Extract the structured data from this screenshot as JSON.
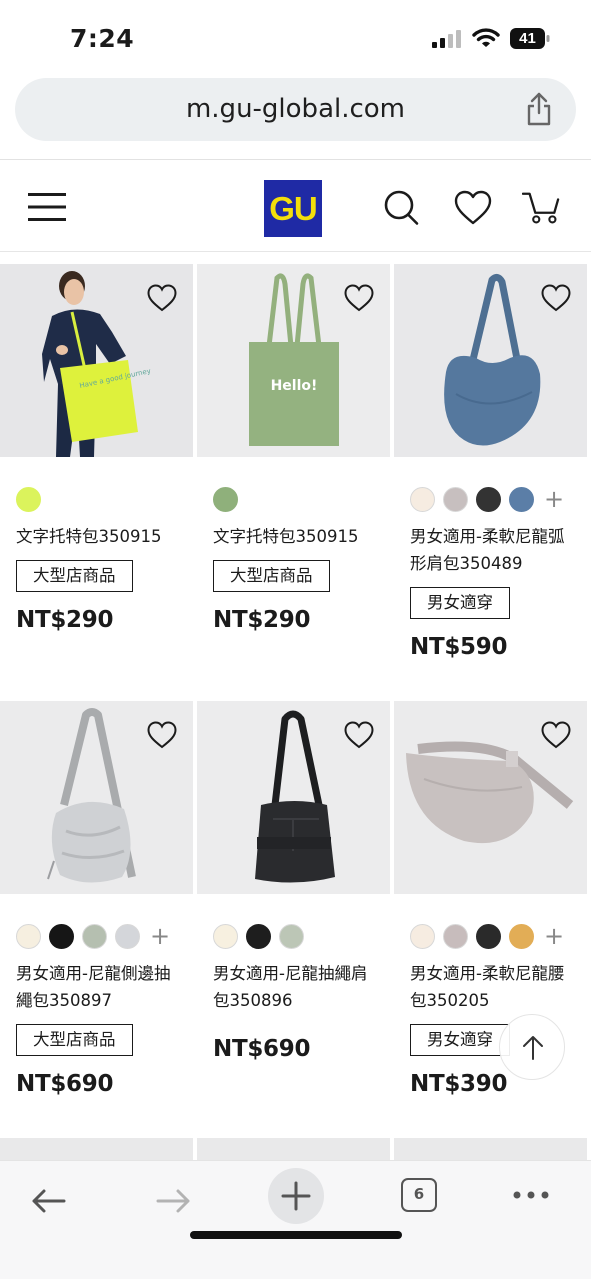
{
  "status_bar": {
    "time": "7:24",
    "battery": "41"
  },
  "browser": {
    "url": "m.gu-global.com",
    "tab_count": "6"
  },
  "site": {
    "logo_text": "GU"
  },
  "products": [
    {
      "name": "文字托特包350915",
      "badge": "大型店商品",
      "price": "NT$290",
      "colors": [
        "#dbf35c"
      ]
    },
    {
      "name": "文字托特包350915",
      "badge": "大型店商品",
      "price": "NT$290",
      "colors": [
        "#8fb07b"
      ]
    },
    {
      "name": "男女適用-柔軟尼龍弧形肩包350489",
      "badge": "男女適穿",
      "price": "NT$590",
      "colors": [
        "#f6ece1",
        "#c7bfbf",
        "#333333",
        "#5b7ea7"
      ],
      "more": "+"
    },
    {
      "name": "男女適用-尼龍側邊抽繩包350897",
      "badge": "大型店商品",
      "price": "NT$690",
      "colors": [
        "#f6efe0",
        "#161616",
        "#b5bfb0",
        "#d4d6da"
      ],
      "more": "+"
    },
    {
      "name": "男女適用-尼龍抽繩肩包350896",
      "badge": "",
      "price": "NT$690",
      "colors": [
        "#f7f0e0",
        "#1e1e1e",
        "#bcc6b6"
      ]
    },
    {
      "name": "男女適用-柔軟尼龍腰包350205",
      "badge": "男女適穿",
      "price": "NT$390",
      "colors": [
        "#f6ece1",
        "#c7bcbc",
        "#2a2a2a",
        "#e2ad56"
      ],
      "more": "+"
    }
  ],
  "images": {
    "p1": "model-yellow-tote",
    "p2": "green-tote-hello",
    "p3": "blue-shoulder-bag",
    "p4": "silver-drawstring-bag",
    "p5": "black-drawstring-bag",
    "p6": "grey-waist-bag"
  },
  "tote_text": {
    "p1": "Have a good journey",
    "p2": "Hello!"
  }
}
